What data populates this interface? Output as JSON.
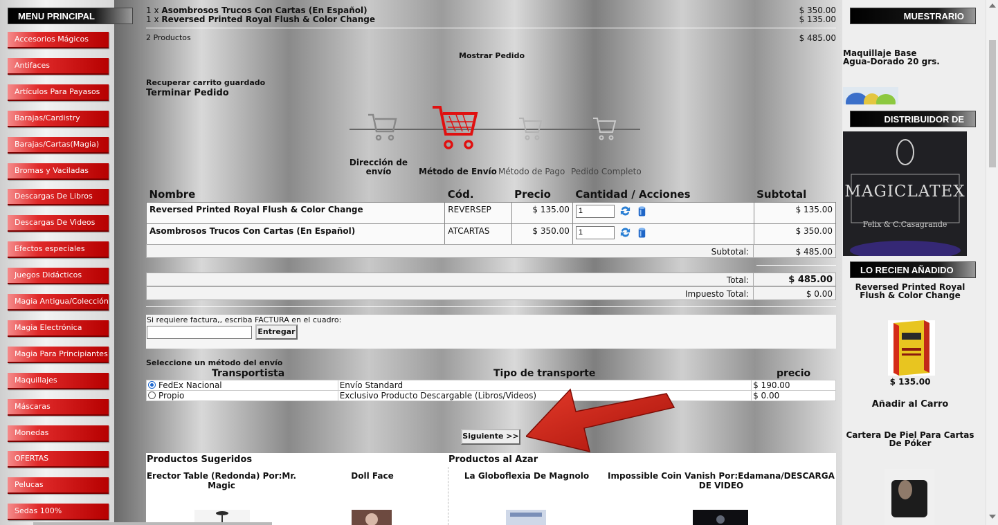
{
  "left_menu": {
    "title": "MENU PRINCIPAL",
    "items": [
      "Accesorios Mágicos",
      "Antifaces",
      "Artículos Para Payasos",
      "Barajas/Cardistry",
      "Barajas/Cartas(Magia)",
      "Bromas y Vaciladas",
      "Descargas De Libros",
      "Descargas De Videos",
      "Efectos especiales",
      "Juegos Didácticos",
      "Magia Antigua/Colección",
      "Magia Electrónica",
      "Magia Para Principiantes",
      "Maquillajes",
      "Máscaras",
      "Monedas",
      "OFERTAS",
      "Pelucas",
      "Sedas 100%"
    ]
  },
  "cart_summary": {
    "line1_qty": "1 x",
    "line1_name": "Asombrosos Trucos Con Cartas (En Español)",
    "line1_price": "$ 350.00",
    "line2_qty": "1 x",
    "line2_name": "Reversed Printed Royal Flush & Color Change",
    "line2_price": "$ 135.00",
    "count": "2 Productos",
    "total": "$ 485.00"
  },
  "links": {
    "show_order": "Mostrar Pedido",
    "recover_cart": "Recuperar carrito guardado",
    "finish_order": "Terminar Pedido"
  },
  "steps": [
    {
      "label_line1": "Dirección de",
      "label_line2": "envío"
    },
    {
      "label": "Método de Envío"
    },
    {
      "label": "Método de Pago"
    },
    {
      "label": "Pedido Completo"
    }
  ],
  "cart_table": {
    "headers": [
      "Nombre",
      "Cód.",
      "Precio",
      "Cantidad / Acciones",
      "Subtotal"
    ],
    "rows": [
      {
        "name": "Reversed Printed Royal Flush & Color Change",
        "code": "REVERSEP",
        "price": "$ 135.00",
        "qty": "1",
        "subtotal": "$ 135.00"
      },
      {
        "name": "Asombrosos Trucos Con Cartas (En Español)",
        "code": "ATCARTAS",
        "price": "$ 350.00",
        "qty": "1",
        "subtotal": "$ 350.00"
      }
    ],
    "subtotal_label": "Subtotal:",
    "subtotal_value": "$ 485.00"
  },
  "totals": {
    "total_label": "Total:",
    "total_value": "$ 485.00",
    "tax_label": "Impuesto Total:",
    "tax_value": "$ 0.00"
  },
  "invoice": {
    "prompt": "Si requiere factura,, escriba FACTURA en el cuadro:",
    "input_value": "",
    "button": "Entregar"
  },
  "shipping": {
    "title": "Seleccione un método del envío",
    "headers": [
      "Transportista",
      "Tipo de transporte",
      "precio"
    ],
    "options": [
      {
        "carrier": "FedEx Nacional",
        "type": "Envío Standard",
        "price": "$ 190.00",
        "selected": true
      },
      {
        "carrier": "Propio",
        "type": "Exclusivo Producto Descargable (Libros/Videos)",
        "price": "$ 0.00",
        "selected": false
      }
    ],
    "next_button": "Siguiente >>"
  },
  "suggested": {
    "title": "Productos Sugeridos",
    "items": [
      "Erector Table (Redonda) Por:Mr. Magic",
      "Doll Face"
    ]
  },
  "random": {
    "title": "Productos al Azar",
    "items": [
      "La Globoflexia De Magnolo",
      "Impossible Coin Vanish Por:Edamana/DESCARGA DE VIDEO"
    ]
  },
  "right_col": {
    "showcase_title": "MUESTRARIO",
    "showcase_item": "Maquillaje Base Agua-Dorado 20 grs.",
    "distributor_title": "DISTRIBUIDOR DE",
    "distributor_logo_text": "MAGICLATEX",
    "distributor_logo_sub": "Felix & C.Casagrande",
    "recent_title": "LO RECIEN AÑADIDO",
    "recent_item": "Reversed Printed Royal Flush & Color Change",
    "recent_price": "$ 135.00",
    "add_to_cart": "Añadir al Carro",
    "next_item": "Cartera De Piel Para Cartas De Póker"
  },
  "colors": {
    "menu_red": "#b60000",
    "cart_active": "#e01010",
    "arrow_red": "#cc1a10",
    "radio_blue": "#1a66d0"
  }
}
